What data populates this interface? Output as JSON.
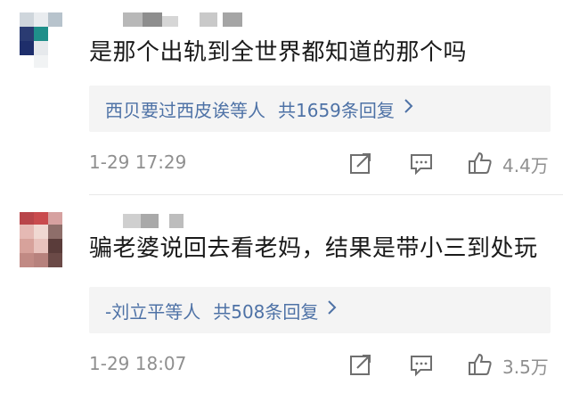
{
  "comments": [
    {
      "text": "是那个出轨到全世界都知道的那个吗",
      "reply_users": "西贝要过西皮诶等人",
      "reply_count": "共1659条回复",
      "time": "1-29 17:29",
      "likes": "4.4万"
    },
    {
      "text": "骗老婆说回去看老妈，结果是带小三到处玩",
      "reply_users": "-刘立平等人",
      "reply_count": "共508条回复",
      "time": "1-29 18:07",
      "likes": "3.5万"
    }
  ],
  "icons": {
    "share": "share-icon",
    "comment": "comment-icon",
    "like": "like-icon",
    "chevron": "chevron-right-icon"
  },
  "colors": {
    "link": "#4e72a6",
    "meta": "#8f8f8f",
    "reply_bg": "#f4f4f4"
  }
}
